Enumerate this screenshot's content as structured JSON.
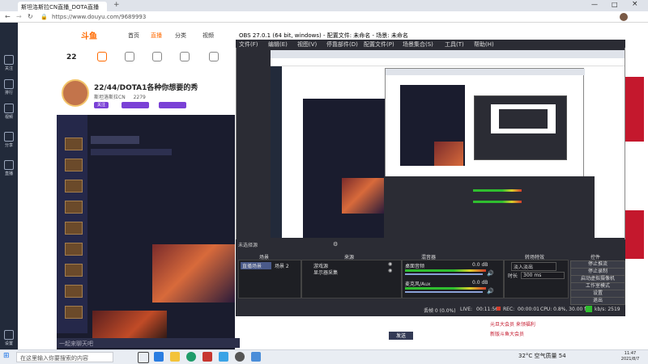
{
  "browser": {
    "tab_title": "斯坦洛斯拉CN直播_DOTA直播",
    "url": "https://www.douyu.com/9689993"
  },
  "left_nav": [
    "关注",
    "排行",
    "视频",
    "分享",
    "直播",
    "设置"
  ],
  "site": {
    "logo": "斗鱼",
    "nav": [
      "首页",
      "直播",
      "分类",
      "视频"
    ]
  },
  "streamer": {
    "room_title": "22/44/DOTA1各种你想要的秀",
    "name": "斯坦洛斯拉CN",
    "followers": "2279",
    "level": "22",
    "follow_btn": "关注"
  },
  "chat": {
    "placeholder": "一起来聊天吧",
    "send": "发送"
  },
  "right_list": [
    "元旦大会员 来领福利",
    "新版斗鱼大会员"
  ],
  "obs": {
    "title": "OBS 27.0.1 (64 bit, windows) - 配置文件: 未命名 - 场景: 未命名",
    "menu": [
      "文件(F)",
      "编辑(E)",
      "视图(V)",
      "停靠部件(D)",
      "配置文件(P)",
      "场景集合(S)",
      "工具(T)",
      "帮助(H)"
    ],
    "no_source": "未选择源",
    "panels": {
      "scenes": "场景",
      "sources": "来源",
      "mixer": "混音器",
      "transitions": "转场特效",
      "controls": "控件"
    },
    "scene_items": [
      "直播场景",
      "场景 2"
    ],
    "source_items": [
      "游戏源",
      "显示器采集"
    ],
    "mixer_tracks": [
      {
        "name": "桌面音频",
        "db": "0.0 dB"
      },
      {
        "name": "麦克风/Aux",
        "db": "0.0 dB"
      }
    ],
    "transition": {
      "type": "淡入淡出",
      "duration_label": "时长",
      "duration": "300 ms"
    },
    "controls": [
      "停止推流",
      "停止录制",
      "启动虚拟摄像机",
      "工作室模式",
      "设置",
      "退出"
    ],
    "status": {
      "dropped": "丢帧 0 (0.0%)",
      "live_label": "LIVE:",
      "live_time": "00:11:56",
      "rec_label": "REC:",
      "rec_time": "00:00:01",
      "cpu": "CPU: 0.8%, 30.00 fps",
      "kbps": "kb/s: 2519"
    }
  },
  "taskbar": {
    "search_placeholder": "在这里输入你要搜索的内容",
    "weather": "32°C 空气质量 54",
    "time": "11:47",
    "date": "2021/8/7"
  },
  "colors": {
    "douyu_orange": "#ff6a00",
    "obs_bg": "#2b2c34",
    "nav_bg": "#222a3a",
    "promo_red": "#c4182d"
  }
}
